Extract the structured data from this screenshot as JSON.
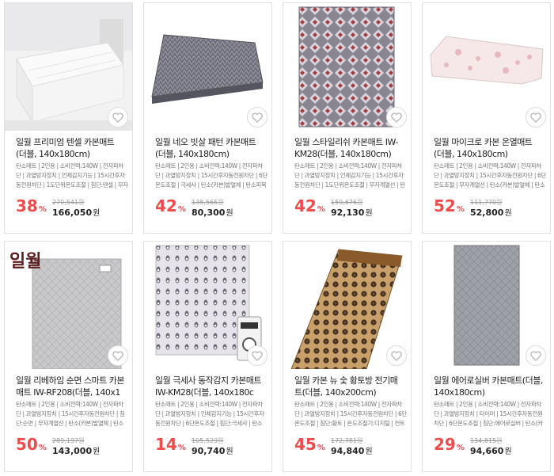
{
  "products": [
    {
      "title": "일월 프리미엄 텐셀 카본매트 (더블, 140x180cm)",
      "tags": "탄소매트 | 2인용 | 소비전력:140W | 전자파차단 | 과열방지장치 | 인체감지기능 | 15시간후자동전원차단 | 1도단위온도조절 | 침단:텐셀 | 무자계열",
      "discount": "38",
      "pct_unit": "%",
      "original_price": "270,541원",
      "sale_price": "166,050",
      "won": "원",
      "image": "white-bed-mattress-photo"
    },
    {
      "title": "일월 네오 빗살 패턴 카본매트 (더블, 140x180cm)",
      "tags": "탄소매트 | 2인용 | 소비전력:140W | 전자파차단 | 과열방지장치 | 15시간후자동전원차단 | 6단온도조절 | 극세사 | 탄소(카본)발열체 | 탄소피복",
      "discount": "42",
      "pct_unit": "%",
      "original_price": "138,565원",
      "sale_price": "80,300",
      "won": "원",
      "image": "gray-herringbone-mat-photo"
    },
    {
      "title": "일월 스타일리쉬 카본매트 IW-KM28(더블, 140x180cm)",
      "tags": "탄소매트 | 2인용 | 소비전력:140W | 전자파차단 | 과열방지장치 | 인체감지기능 | 15시간후자동전원차단 | 1도단위온도조절 | 무자계열선 | 탄소(카...",
      "discount": "42",
      "pct_unit": "%",
      "original_price": "159,676원",
      "sale_price": "92,130",
      "won": "원",
      "image": "geometric-pattern-mat-photo"
    },
    {
      "title": "일월 마이크로 카본 온열매트 (더블, 140x180cm)",
      "tags": "탄소매트 | 2인용 | 소비전력:140W | 전자파차단 | 과열방지장치 | 15시간후자동전원차단 | 6단온도조절 | 무자계열선 | 탄소(카본)발열체 | 탄소피복...",
      "discount": "52",
      "pct_unit": "%",
      "original_price": "111,770원",
      "sale_price": "52,800",
      "won": "원",
      "image": "pink-floral-mat-photo"
    },
    {
      "title": "일월 리베하임 순면 스마트 카본매트 IW-RF208(더블, 140x1",
      "tags": "탄소매트 | 2인용 | 소비전력:140W | 전자파차단 | 과열방지장치 | 15시간후자동전원차단 | 침단:순면 | 무자계열선 | 탄소(카본)발열체 | 탄소피복체...",
      "discount": "50",
      "pct_unit": "%",
      "original_price": "289,197원",
      "sale_price": "143,000",
      "won": "원",
      "image": "gray-quilted-mat-with-logo-photo"
    },
    {
      "title": "일월 극세사 동작감지 카본매트 IW-KM28(더블, 140x180c",
      "tags": "탄소매트 | 2인용 | 소비전력:140W | 전자파차단 | 과열방지장치 | 인체감지기능 | 15시간후자동전원차단 | 6단온도조절 | 침단:극세사 | 탄소(카본)발열체 | 탄소피...",
      "discount": "14",
      "pct_unit": "%",
      "original_price": "105,529원",
      "sale_price": "90,740",
      "won": "원",
      "image": "penguin-pattern-mat-with-controller-photo"
    },
    {
      "title": "일월 카본 뉴 숯 황토방 전기매트(더블, 140x200cm)",
      "tags": "탄소매트 | 2인용 | 소비전력:140W | 전자파차단 | 과열방지장치 | 15시간후자동전원차단 | 6단온도조절 | 침단:황토 | 온도조절기:디지털 | 컨트롤러에스터(TP합판) | 재료:황토,참숯...",
      "discount": "45",
      "pct_unit": "%",
      "original_price": "172,781원",
      "sale_price": "94,840",
      "won": "원",
      "image": "brown-charcoal-dot-mat-photo"
    },
    {
      "title": "일월 에어로실버 카본매트(더블, 140x180cm)",
      "tags": "탄소매트 | 2인용 | 소비전력:140W | 전자파차단 | 과열방지장치 | 타이머 | 15시간후자동전원차단 | 6단온도조절 | 침단:에어로실버 | 탄소(카본)발열체...",
      "discount": "29",
      "pct_unit": "%",
      "original_price": "134,815원",
      "sale_price": "94,660",
      "won": "원",
      "image": "gray-quilted-mat-photo"
    }
  ],
  "logo_text": "일월"
}
